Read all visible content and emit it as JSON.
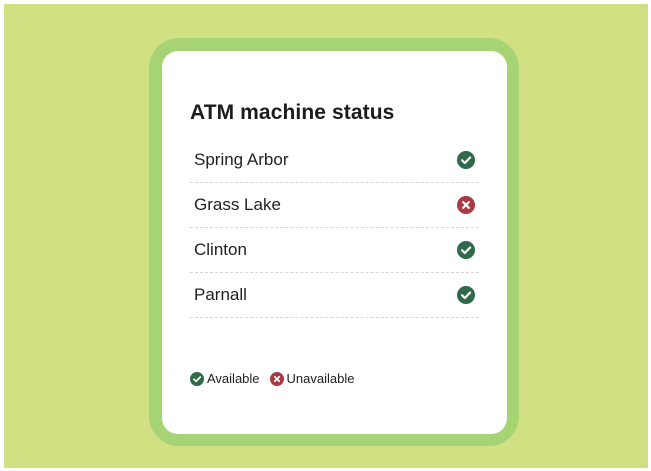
{
  "colors": {
    "background": "#d2e084",
    "frame": "#a6d474",
    "available": "#2f6b4a",
    "unavailable": "#a83a45"
  },
  "card": {
    "title": "ATM machine status",
    "items": [
      {
        "label": "Spring Arbor",
        "status": "available",
        "icon": "check-circle-icon"
      },
      {
        "label": "Grass Lake",
        "status": "unavailable",
        "icon": "x-circle-icon"
      },
      {
        "label": "Clinton",
        "status": "available",
        "icon": "check-circle-icon"
      },
      {
        "label": "Parnall",
        "status": "available",
        "icon": "check-circle-icon"
      }
    ],
    "legend": {
      "available_label": "Available",
      "unavailable_label": "Unavailable"
    }
  }
}
